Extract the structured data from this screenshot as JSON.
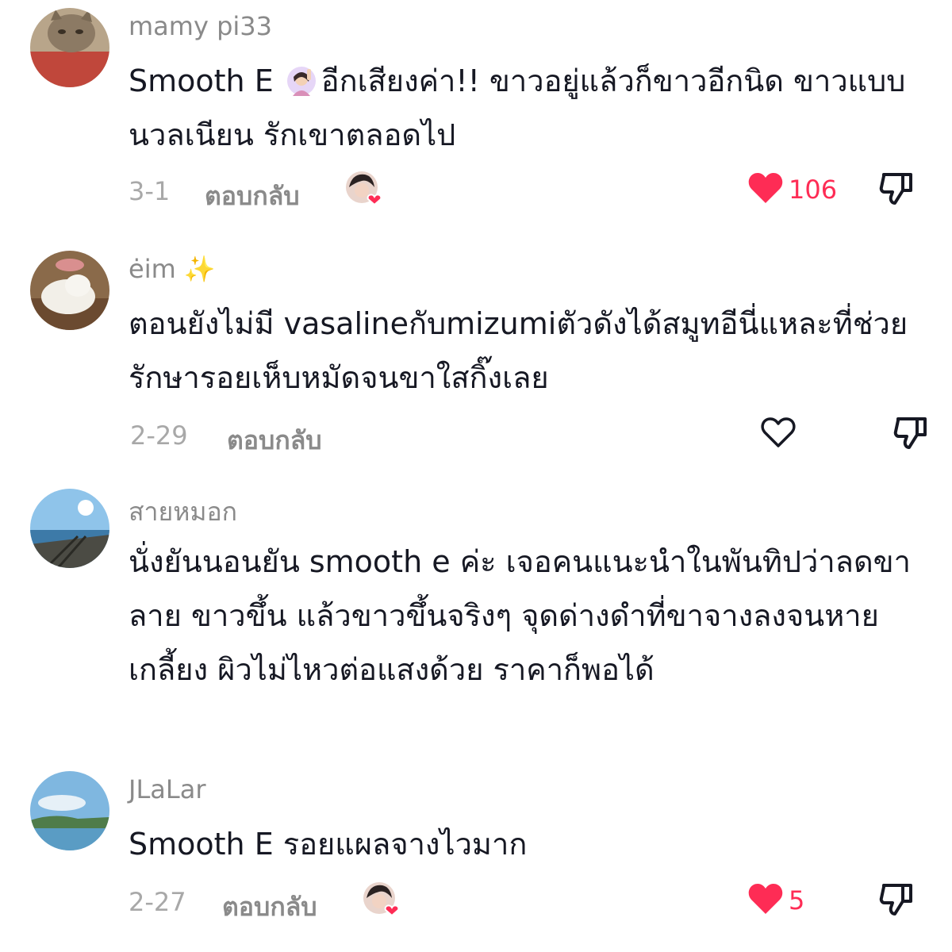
{
  "reply_label": "ตอบกลับ",
  "comments": [
    {
      "username": "mamy pi33",
      "text_pre": "Smooth E ",
      "text_post": "อีกเสียงค่า!! ขาวอยู่แล้วก็ขาวอีกนิด ขาวแบบนวลเนียน รักเขาตลอดไป",
      "date": "3-1",
      "likes": "106",
      "liked": true,
      "creator_liked": true
    },
    {
      "username": "ėim",
      "username_emoji": "✨",
      "text": "ตอนยังไม่มี vasalineกับmizumiตัวดังได้สมูทอีนี่แหละที่ช่วยรักษารอยเห็บหมัดจนขาใสกิ๊งเลย",
      "date": "2-29",
      "liked": false,
      "creator_liked": false
    },
    {
      "username": "สายหมอก",
      "text": "นั่งยันนอนยัน smooth e ค่ะ เจอคนแนะนำในพันทิปว่าลดขาลาย ขาวขึ้น แล้วขาวขึ้นจริงๆ จุดด่างดำที่ขาจางลงจนหายเกลี้ยง ผิวไม่ไหวต่อแสงด้วย ราคาก็พอได้"
    },
    {
      "username": "JLaLar",
      "text": "Smooth E รอยแผลจางไวมาก",
      "date": "2-27",
      "likes": "5",
      "liked": true,
      "creator_liked": true
    }
  ],
  "colors": {
    "like": "#fe2c55",
    "text": "#161823",
    "muted": "#8a8a8a"
  }
}
